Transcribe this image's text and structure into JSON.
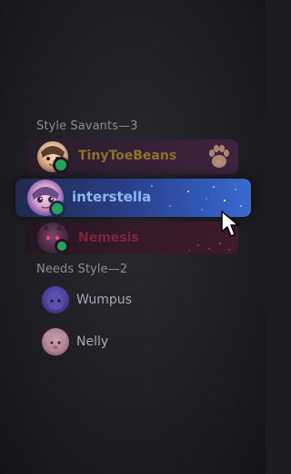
{
  "groups": [
    {
      "header": "Style Savants—3",
      "members": [
        {
          "name": "TinyToeBeans",
          "status": "online",
          "name_color": "#b28a2a"
        },
        {
          "name": "interstella",
          "status": "online",
          "name_color": "#8ab8f2",
          "hovered": true
        },
        {
          "name": "Nemesis",
          "status": "online",
          "name_color": "#a82446"
        }
      ]
    },
    {
      "header": "Needs Style—2",
      "members": [
        {
          "name": "Wumpus"
        },
        {
          "name": "Nelly"
        }
      ]
    }
  ],
  "icons": [
    "paw-icon",
    "mouse-cursor-icon"
  ],
  "colors": {
    "online": "#23a55a",
    "background": "#1e1e24",
    "hover_row": "#3158b8"
  }
}
